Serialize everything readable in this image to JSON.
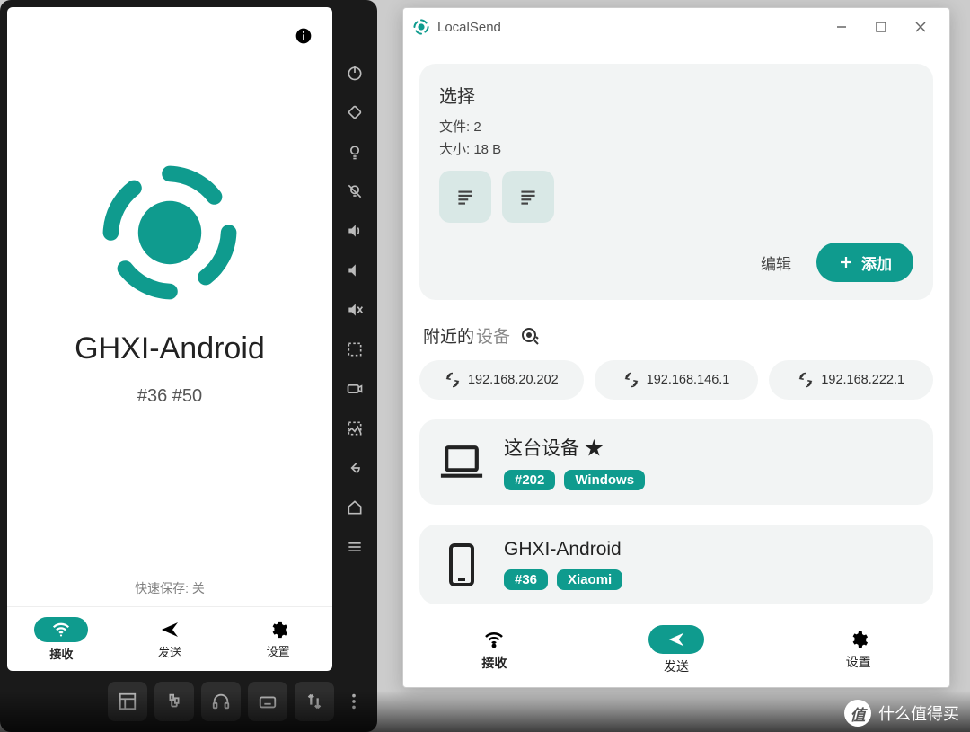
{
  "phone": {
    "title": "GHXI-Android",
    "hash": "#36 #50",
    "quick_save": "快速保存: 关",
    "nav": {
      "receive": "接收",
      "send": "发送",
      "settings": "设置"
    }
  },
  "side_icons": [
    "power-icon",
    "rotate-icon",
    "bulb-on-icon",
    "bulb-off-icon",
    "volume-up-icon",
    "volume-down-icon",
    "volume-mute-icon",
    "crop-icon",
    "camera-icon",
    "picture-icon",
    "back-icon",
    "home-icon",
    "menu-icon"
  ],
  "bottom_icons": [
    "layout-icon",
    "usb-icon",
    "headphones-icon",
    "keyboard-icon",
    "transfer-icon",
    "more-icon"
  ],
  "win": {
    "app_name": "LocalSend",
    "card": {
      "title": "选择",
      "files_label": "文件: 2",
      "size_label": "大小: 18 B",
      "edit": "编辑",
      "add": "添加"
    },
    "nearby": {
      "label1": "附近的",
      "label2": "设备"
    },
    "ips": [
      "192.168.20.202",
      "192.168.146.1",
      "192.168.222.1"
    ],
    "device1": {
      "name": "这台设备 ★",
      "badges": [
        "#202",
        "Windows"
      ]
    },
    "device2": {
      "name": "GHXI-Android",
      "badges": [
        "#36",
        "Xiaomi"
      ]
    },
    "nav": {
      "receive": "接收",
      "send": "发送",
      "settings": "设置"
    }
  },
  "watermark": "什么值得买"
}
